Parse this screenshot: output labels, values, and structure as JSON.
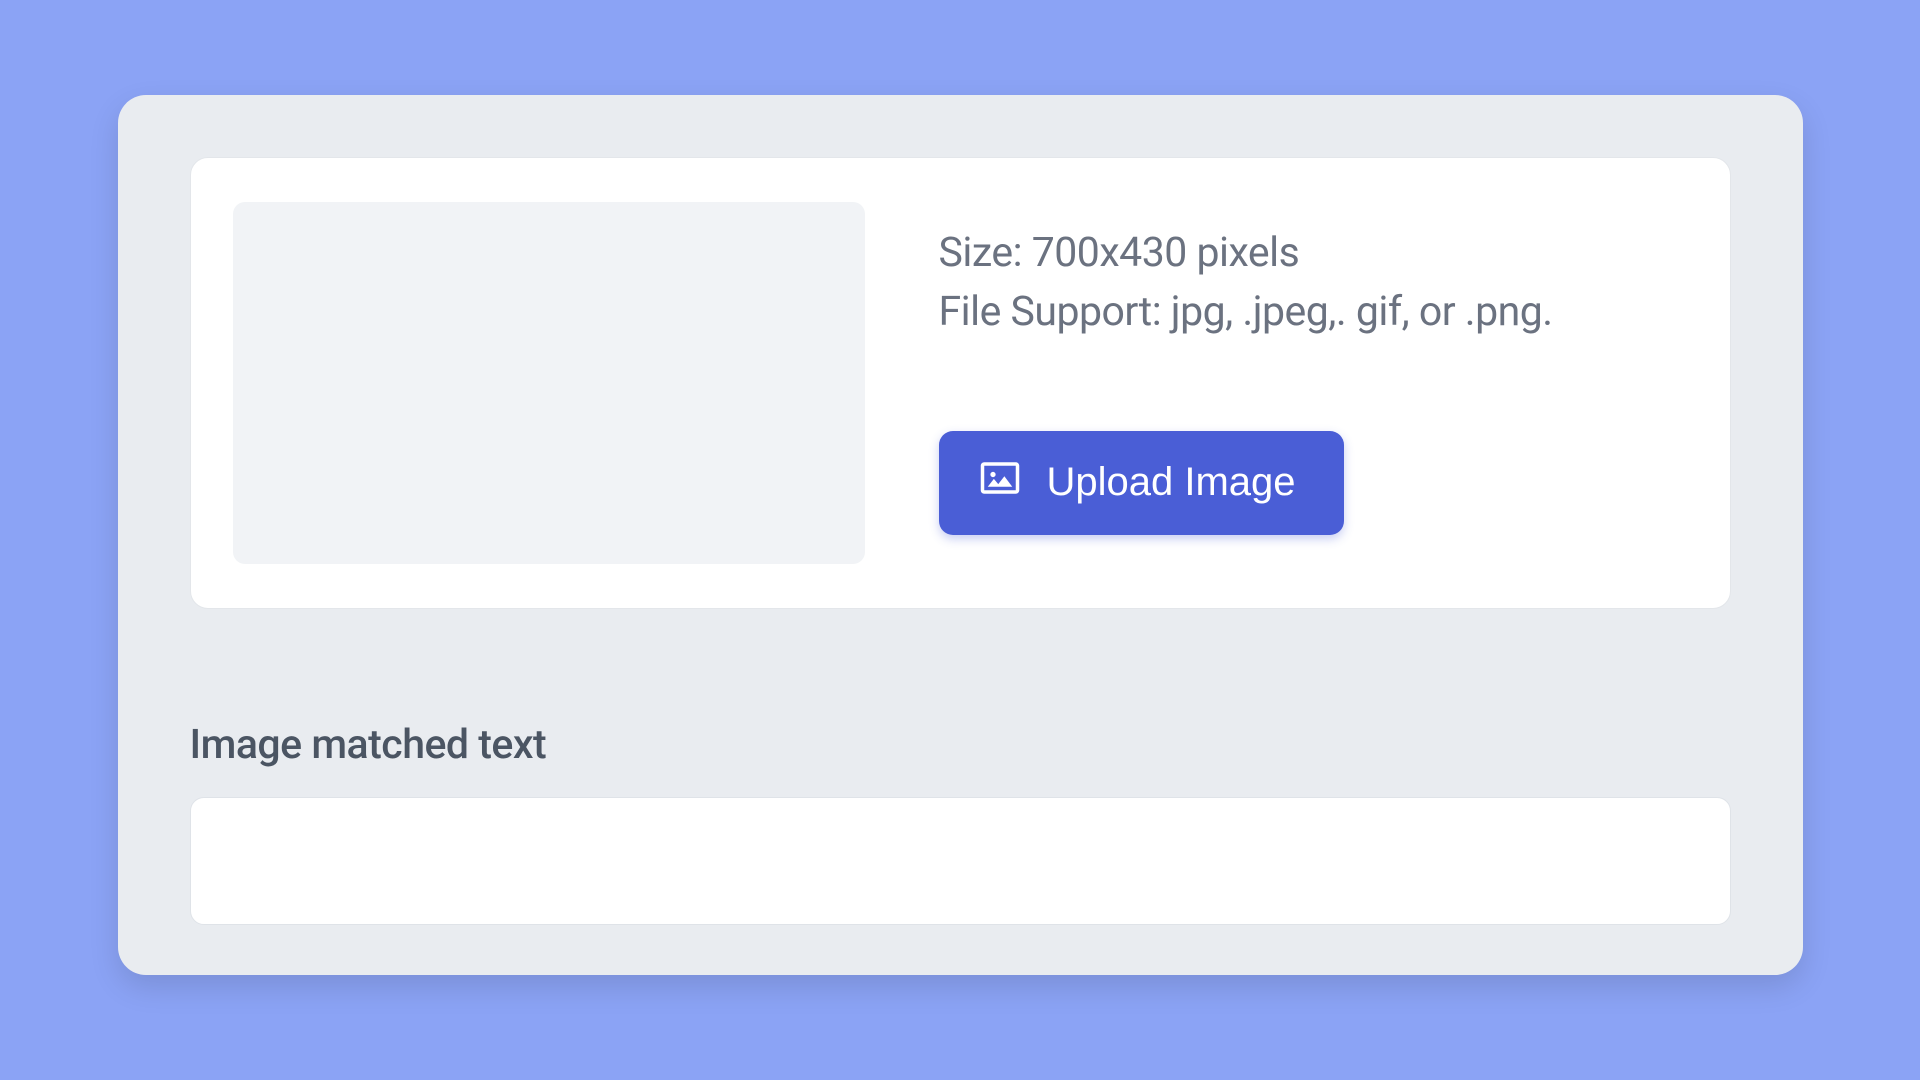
{
  "upload": {
    "size_label": "Size:",
    "size_value": "700x430 pixels",
    "file_support_label": "File Support:",
    "file_support_value": "jpg, .jpeg,. gif, or .png.",
    "button_label": "Upload Image"
  },
  "matched_text": {
    "label": "Image matched text",
    "value": ""
  }
}
